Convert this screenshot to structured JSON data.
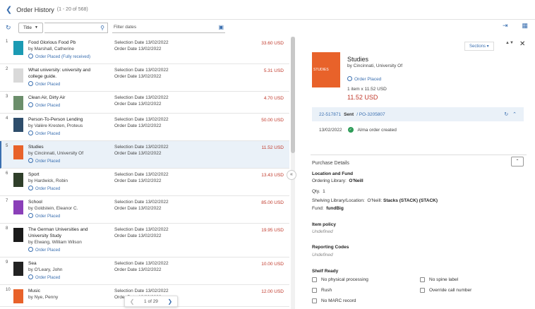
{
  "header": {
    "back_icon": "chevron-left-icon",
    "title": "Order History",
    "count": "(1 - 20 of 568)"
  },
  "toolbar": {
    "title_select": "Title",
    "filter_placeholder": "Filter dates"
  },
  "orders": [
    {
      "num": "1",
      "title": "Food Glorious Food Pb",
      "author": "by Marshall, Catherine",
      "status": "Order Placed (Fully received)",
      "selection": "Selection Date 13/02/2022",
      "order": "Order Date 13/02/2022",
      "price": "33.60 USD",
      "thumb": "#1b9ab3"
    },
    {
      "num": "2",
      "title": "What university: university and",
      "title2": "college guide.",
      "author": "",
      "status": "Order Placed",
      "selection": "Selection Date 13/02/2022",
      "order": "Order Date 13/02/2022",
      "price": "5.31 USD",
      "thumb": "#d9d9d9"
    },
    {
      "num": "3",
      "title": "Clean Air, Dirty Air",
      "author": "",
      "status": "Order Placed",
      "selection": "Selection Date 13/02/2022",
      "order": "Order Date 13/02/2022",
      "price": "4.70 USD",
      "thumb": "#6b8e6b"
    },
    {
      "num": "4",
      "title": "Person-To-Person Lending",
      "author": "by Valère Kresten, Proteus",
      "status": "Order Placed",
      "selection": "Selection Date 13/02/2022",
      "order": "Order Date 13/02/2022",
      "price": "50.00 USD",
      "thumb": "#2e4d6b"
    },
    {
      "num": "5",
      "title": "Studies",
      "author": "by Cincinnati, University Of",
      "status": "Order Placed",
      "selection": "Selection Date 13/02/2022",
      "order": "Order Date 13/02/2022",
      "price": "11.52 USD",
      "thumb": "#e8622a",
      "selected": true
    },
    {
      "num": "6",
      "title": "Sport",
      "author": "by Hardwick, Robin",
      "status": "Order Placed",
      "selection": "Selection Date 13/02/2022",
      "order": "Order Date 13/02/2022",
      "price": "13.43 USD",
      "thumb": "#2f3f2a"
    },
    {
      "num": "7",
      "title": "School",
      "author": "by Goldstein, Eleanor C.",
      "status": "Order Placed",
      "selection": "Selection Date 13/02/2022",
      "order": "Order Date 13/02/2022",
      "price": "85.00 USD",
      "thumb": "#8a3fb8"
    },
    {
      "num": "8",
      "title": "The German Universities and",
      "title2": "University Study",
      "author": "by Elwang, William Wilson",
      "status": "Order Placed",
      "selection": "Selection Date 13/02/2022",
      "order": "Order Date 13/02/2022",
      "price": "19.95 USD",
      "thumb": "#1a1a1a"
    },
    {
      "num": "9",
      "title": "Sea",
      "author": "by O'Leary, John",
      "status": "Order Placed",
      "selection": "Selection Date 13/02/2022",
      "order": "Order Date 13/02/2022",
      "price": "10.00 USD",
      "thumb": "#222"
    },
    {
      "num": "10",
      "title": "Music",
      "author": "by Nye, Penny",
      "status": "",
      "selection": "Selection Date 13/02/2022",
      "order": "Order Date 13/02/2022",
      "price": "12.00 USD",
      "thumb": "#e8622a"
    }
  ],
  "pager": {
    "label": "1 of 29"
  },
  "detail": {
    "sections_label": "Sections",
    "cover_text": "STUDIES",
    "title": "Studies",
    "author": "by Cincinnati, University Of",
    "status": "Order Placed",
    "items": "1 item x 11.52 USD",
    "price": "11.52 USD",
    "po_number": "22-517871",
    "po_state": "Sent",
    "po_link": "/ PO-3205807",
    "event_date": "13/02/2022",
    "event_text": "Alma order created",
    "purchase_title": "Purchase Details",
    "location_heading": "Location and Fund",
    "ordering_label": "Ordering Library:",
    "ordering_value": "O'Neill",
    "qty_label": "Qty.",
    "qty_value": "1",
    "shelving_label": "Shelving Library/Location:",
    "shelving_lib": "O'Neill:",
    "shelving_value": "Stacks (STACK) (STACK)",
    "fund_label": "Fund:",
    "fund_value": "fundBig",
    "item_policy_heading": "Item policy",
    "item_policy_value": "Undefined",
    "reporting_heading": "Reporting Codes",
    "reporting_value": "Undefined",
    "shelf_heading": "Shelf Ready",
    "cb_no_physical": "No physical processing",
    "cb_rush": "Rush",
    "cb_no_marc": "No MARC record",
    "cb_no_spine": "No spine label",
    "cb_override": "Override call number"
  }
}
